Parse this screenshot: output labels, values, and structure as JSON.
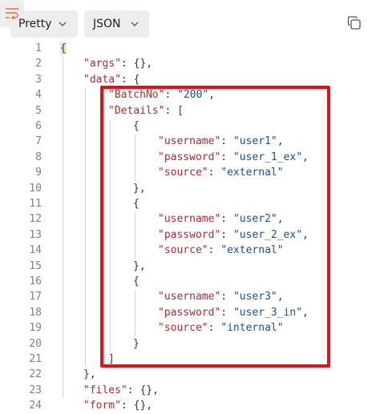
{
  "toolbar": {
    "format_label": "Pretty",
    "language_label": "JSON"
  },
  "code": {
    "lines": [
      {
        "n": "1",
        "indent": 0,
        "parts": [
          [
            "p",
            "{"
          ]
        ]
      },
      {
        "n": "2",
        "indent": 1,
        "parts": [
          [
            "k",
            "\"args\""
          ],
          [
            "p",
            ": {},"
          ]
        ]
      },
      {
        "n": "3",
        "indent": 1,
        "parts": [
          [
            "k",
            "\"data\""
          ],
          [
            "p",
            ": {"
          ]
        ]
      },
      {
        "n": "4",
        "indent": 2,
        "parts": [
          [
            "k",
            "\"BatchNo\""
          ],
          [
            "p",
            ": "
          ],
          [
            "s",
            "\"200\""
          ],
          [
            "p",
            ","
          ]
        ]
      },
      {
        "n": "5",
        "indent": 2,
        "parts": [
          [
            "k",
            "\"Details\""
          ],
          [
            "p",
            ": ["
          ]
        ]
      },
      {
        "n": "6",
        "indent": 3,
        "parts": [
          [
            "p",
            "{"
          ]
        ]
      },
      {
        "n": "7",
        "indent": 4,
        "parts": [
          [
            "k",
            "\"username\""
          ],
          [
            "p",
            ": "
          ],
          [
            "s",
            "\"user1\""
          ],
          [
            "p",
            ","
          ]
        ]
      },
      {
        "n": "8",
        "indent": 4,
        "parts": [
          [
            "k",
            "\"password\""
          ],
          [
            "p",
            ": "
          ],
          [
            "s",
            "\"user_1_ex\""
          ],
          [
            "p",
            ","
          ]
        ]
      },
      {
        "n": "9",
        "indent": 4,
        "parts": [
          [
            "k",
            "\"source\""
          ],
          [
            "p",
            ": "
          ],
          [
            "s",
            "\"external\""
          ]
        ]
      },
      {
        "n": "10",
        "indent": 3,
        "parts": [
          [
            "p",
            "},"
          ]
        ]
      },
      {
        "n": "11",
        "indent": 3,
        "parts": [
          [
            "p",
            "{"
          ]
        ]
      },
      {
        "n": "12",
        "indent": 4,
        "parts": [
          [
            "k",
            "\"username\""
          ],
          [
            "p",
            ": "
          ],
          [
            "s",
            "\"user2\""
          ],
          [
            "p",
            ","
          ]
        ]
      },
      {
        "n": "13",
        "indent": 4,
        "parts": [
          [
            "k",
            "\"password\""
          ],
          [
            "p",
            ": "
          ],
          [
            "s",
            "\"user_2_ex\""
          ],
          [
            "p",
            ","
          ]
        ]
      },
      {
        "n": "14",
        "indent": 4,
        "parts": [
          [
            "k",
            "\"source\""
          ],
          [
            "p",
            ": "
          ],
          [
            "s",
            "\"external\""
          ]
        ]
      },
      {
        "n": "15",
        "indent": 3,
        "parts": [
          [
            "p",
            "},"
          ]
        ]
      },
      {
        "n": "16",
        "indent": 3,
        "parts": [
          [
            "p",
            "{"
          ]
        ]
      },
      {
        "n": "17",
        "indent": 4,
        "parts": [
          [
            "k",
            "\"username\""
          ],
          [
            "p",
            ": "
          ],
          [
            "s",
            "\"user3\""
          ],
          [
            "p",
            ","
          ]
        ]
      },
      {
        "n": "18",
        "indent": 4,
        "parts": [
          [
            "k",
            "\"password\""
          ],
          [
            "p",
            ": "
          ],
          [
            "s",
            "\"user_3_in\""
          ],
          [
            "p",
            ","
          ]
        ]
      },
      {
        "n": "19",
        "indent": 4,
        "parts": [
          [
            "k",
            "\"source\""
          ],
          [
            "p",
            ": "
          ],
          [
            "s",
            "\"internal\""
          ]
        ]
      },
      {
        "n": "20",
        "indent": 3,
        "parts": [
          [
            "p",
            "}"
          ]
        ]
      },
      {
        "n": "21",
        "indent": 2,
        "parts": [
          [
            "p",
            "]"
          ]
        ]
      },
      {
        "n": "22",
        "indent": 1,
        "parts": [
          [
            "p",
            "},"
          ]
        ]
      },
      {
        "n": "23",
        "indent": 1,
        "parts": [
          [
            "k",
            "\"files\""
          ],
          [
            "p",
            ": {},"
          ]
        ]
      },
      {
        "n": "24",
        "indent": 1,
        "parts": [
          [
            "k",
            "\"form\""
          ],
          [
            "p",
            ": {},"
          ]
        ]
      }
    ]
  },
  "colors": {
    "key": "#a6302f",
    "string": "#1d4f91",
    "punctuation": "#383838",
    "line_number": "#808080",
    "highlight_box": "#e0101d",
    "wrap_icon": "#f26b3a"
  },
  "icons": {
    "format_dropdown": "chevron-down-icon",
    "language_dropdown": "chevron-down-icon",
    "wrap": "word-wrap-icon",
    "copy": "copy-icon"
  }
}
